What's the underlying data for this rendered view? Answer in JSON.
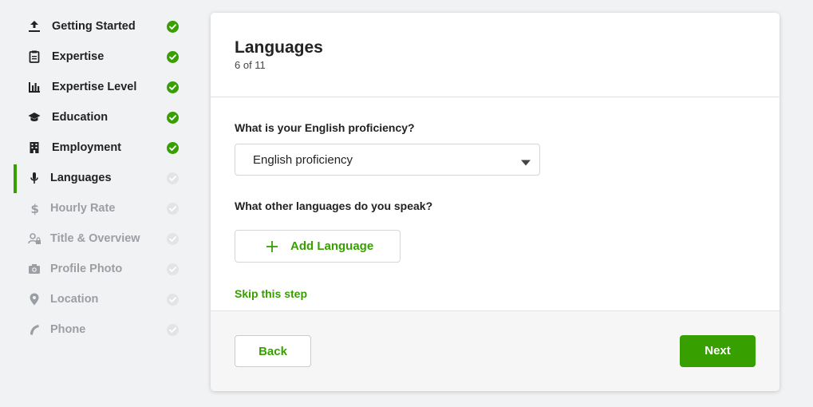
{
  "colors": {
    "accent": "#37a000",
    "pending": "#9b9ea3",
    "text": "#222222"
  },
  "sidebar": {
    "items": [
      {
        "label": "Getting Started",
        "icon": "upload-icon",
        "status": "done"
      },
      {
        "label": "Expertise",
        "icon": "clipboard-icon",
        "status": "done"
      },
      {
        "label": "Expertise Level",
        "icon": "bar-chart-icon",
        "status": "done"
      },
      {
        "label": "Education",
        "icon": "graduation-cap-icon",
        "status": "done"
      },
      {
        "label": "Employment",
        "icon": "building-icon",
        "status": "done"
      },
      {
        "label": "Languages",
        "icon": "microphone-icon",
        "status": "active"
      },
      {
        "label": "Hourly Rate",
        "icon": "dollar-icon",
        "status": "pending"
      },
      {
        "label": "Title & Overview",
        "icon": "user-lock-icon",
        "status": "pending"
      },
      {
        "label": "Profile Photo",
        "icon": "camera-icon",
        "status": "pending"
      },
      {
        "label": "Location",
        "icon": "map-pin-icon",
        "status": "pending"
      },
      {
        "label": "Phone",
        "icon": "phone-icon",
        "status": "pending"
      }
    ]
  },
  "main": {
    "title": "Languages",
    "step_counter": "6 of 11",
    "english_question": "What is your English proficiency?",
    "english_select": {
      "value": "English proficiency",
      "icon": "caret-down-icon"
    },
    "other_question": "What other languages do you speak?",
    "add_language_label": "Add Language",
    "skip_label": "Skip this step"
  },
  "footer": {
    "back_label": "Back",
    "next_label": "Next"
  }
}
